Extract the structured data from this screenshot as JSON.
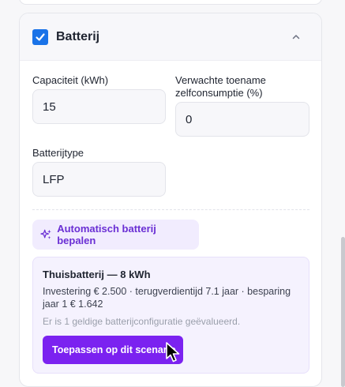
{
  "section": {
    "title": "Batterij",
    "checked": true,
    "accent_color": "#1a73e8"
  },
  "fields": {
    "capacity": {
      "label": "Capaciteit (kWh)",
      "value": "15"
    },
    "self_consumption": {
      "label": "Verwachte toename zelfconsumptie (%)",
      "value": "0"
    },
    "battery_type": {
      "label": "Batterijtype",
      "value": "LFP"
    }
  },
  "auto_button": {
    "label": "Automatisch batterij bepalen",
    "icon": "sparkles-icon",
    "color": "#6a2fd4"
  },
  "result": {
    "title": "Thuisbatterij — 8 kWh",
    "description": "Investering € 2.500 · terugverdientijd 7.1 jaar · besparing jaar 1 € 1.642",
    "note": "Er is 1 geldige batterijconfiguratie geëvalueerd.",
    "apply_label": "Toepassen op dit scenario",
    "apply_color": "#7b22f0"
  }
}
